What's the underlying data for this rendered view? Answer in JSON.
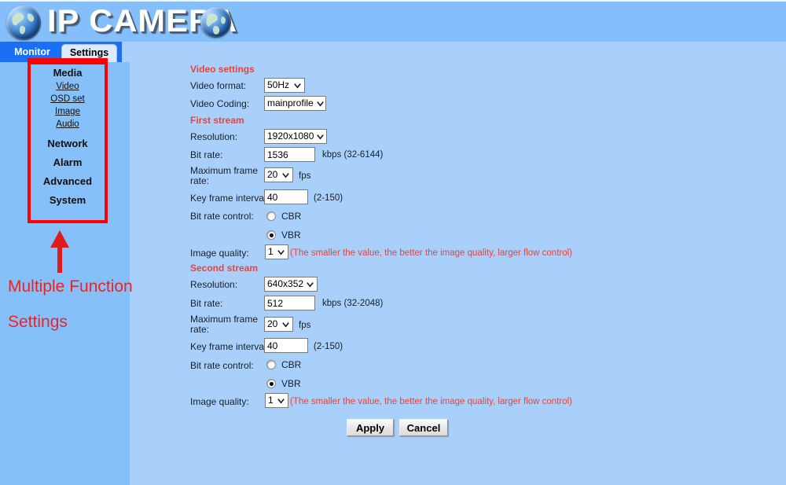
{
  "header": {
    "title": "IP CAMERA",
    "globe_left_icon": "globe-icon",
    "globe_right_icon": "globe-icon"
  },
  "tabs": [
    {
      "label": "Monitor",
      "active": false
    },
    {
      "label": "Settings",
      "active": true
    }
  ],
  "sidebar": {
    "groups": [
      {
        "label": "Media",
        "links": [
          "Video",
          "OSD set",
          "Image",
          "Audio"
        ]
      },
      {
        "label": "Network",
        "links": []
      },
      {
        "label": "Alarm",
        "links": []
      },
      {
        "label": "Advanced",
        "links": []
      },
      {
        "label": "System",
        "links": []
      }
    ],
    "items": [
      {
        "label": "Media",
        "type": "group"
      },
      {
        "label": "Video",
        "type": "link"
      },
      {
        "label": "OSD set",
        "type": "link"
      },
      {
        "label": "Image",
        "type": "link"
      },
      {
        "label": "Audio",
        "type": "link"
      },
      {
        "label": "Network",
        "type": "group"
      },
      {
        "label": "Alarm",
        "type": "group"
      },
      {
        "label": "Advanced",
        "type": "group"
      },
      {
        "label": "System",
        "type": "group"
      }
    ]
  },
  "annotation": {
    "line1": "Multiple Function",
    "line2": "Settings",
    "color": "#ef2222",
    "arrow_icon": "up-arrow-icon"
  },
  "form": {
    "video_settings_head": "Video settings",
    "video_format_label": "Video format:",
    "video_format_value": "50Hz",
    "video_coding_label": "Video Coding:",
    "video_coding_value": "mainprofile",
    "first_stream_head": "First stream",
    "s1_resolution_label": "Resolution:",
    "s1_resolution_value": "1920x1080",
    "s1_bitrate_label": "Bit rate:",
    "s1_bitrate_value": "1536",
    "s1_bitrate_unit": "kbps (32-6144)",
    "s1_framerate_label": "Maximum frame rate:",
    "s1_framerate_value": "20",
    "s1_framerate_unit": "fps",
    "s1_keyframe_label": "Key frame interval:",
    "s1_keyframe_value": "40",
    "s1_keyframe_unit": "(2-150)",
    "s1_bitratectrl_label": "Bit rate control:",
    "s1_cbr_label": "CBR",
    "s1_cbr_selected": false,
    "s1_vbr_label": "VBR",
    "s1_vbr_selected": true,
    "s1_quality_label": "Image quality:",
    "s1_quality_value": "1",
    "s1_quality_hint": "(The smaller the value, the better the image quality, larger flow control)",
    "second_stream_head": "Second stream",
    "s2_resolution_label": "Resolution:",
    "s2_resolution_value": "640x352",
    "s2_bitrate_label": "Bit rate:",
    "s2_bitrate_value": "512",
    "s2_bitrate_unit": "kbps (32-2048)",
    "s2_framerate_label": "Maximum frame rate:",
    "s2_framerate_value": "20",
    "s2_framerate_unit": "fps",
    "s2_keyframe_label": "Key frame interval:",
    "s2_keyframe_value": "40",
    "s2_keyframe_unit": "(2-150)",
    "s2_bitratectrl_label": "Bit rate control:",
    "s2_cbr_label": "CBR",
    "s2_cbr_selected": false,
    "s2_vbr_label": "VBR",
    "s2_vbr_selected": true,
    "s2_quality_label": "Image quality:",
    "s2_quality_value": "1",
    "s2_quality_hint": "(The smaller the value, the better the image quality, larger flow control)",
    "apply_label": "Apply",
    "cancel_label": "Cancel"
  },
  "colors": {
    "header_bg": "#85bffb",
    "tab_active_bg": "#ddeafb",
    "tab_strip_bg": "#1a6ff5",
    "left_panel_bg": "#86c0fb",
    "content_bg": "#a9cffb",
    "section_red": "#e8443c",
    "annotation_red": "#ef2222"
  }
}
